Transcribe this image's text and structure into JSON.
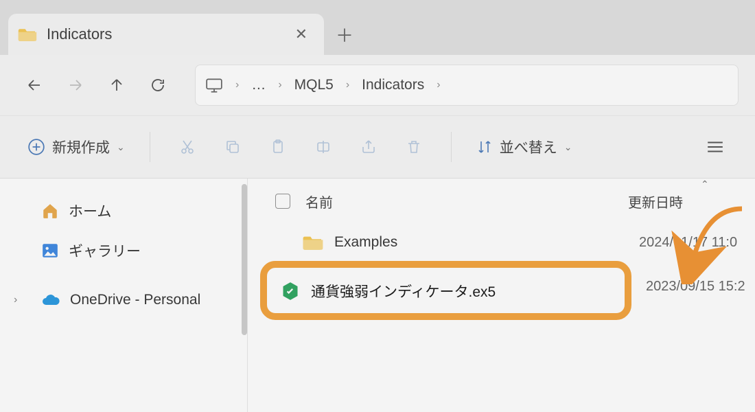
{
  "tab": {
    "title": "Indicators"
  },
  "breadcrumb": {
    "ellipsis": "…",
    "seg1": "MQL5",
    "seg2": "Indicators"
  },
  "toolbar": {
    "new_label": "新規作成",
    "sort_label": "並べ替え"
  },
  "sidebar": {
    "home": "ホーム",
    "gallery": "ギャラリー",
    "onedrive": "OneDrive - Personal"
  },
  "columns": {
    "name": "名前",
    "date": "更新日時"
  },
  "files": [
    {
      "name": "Examples",
      "date": "2024/01/17 11:0",
      "type": "folder"
    },
    {
      "name": "通貨強弱インディケータ.ex5",
      "date": "2023/09/15 15:2",
      "type": "ex5"
    }
  ]
}
